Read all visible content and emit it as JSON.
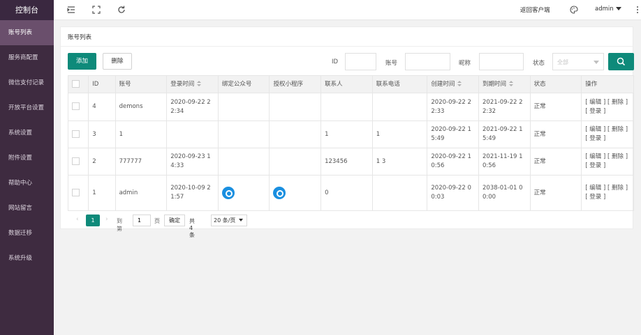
{
  "sidebar": {
    "logo": "控制台",
    "items": [
      {
        "label": "账号列表",
        "active": true
      },
      {
        "label": "服务商配置"
      },
      {
        "label": "微信支付记录"
      },
      {
        "label": "开放平台设置"
      },
      {
        "label": "系统设置"
      },
      {
        "label": "附件设置"
      },
      {
        "label": "帮助中心"
      },
      {
        "label": "网站留言"
      },
      {
        "label": "数据迁移"
      },
      {
        "label": "系统升级"
      }
    ]
  },
  "header": {
    "return_link": "返回客户端",
    "user": "admin",
    "icons": [
      "menu-collapse-icon",
      "fullscreen-icon",
      "refresh-icon",
      "theme-icon",
      "more-vertical-icon"
    ]
  },
  "card": {
    "title": "账号列表",
    "add_label": "添加",
    "delete_label": "删除"
  },
  "filters": {
    "id_label": "ID",
    "id_value": "",
    "account_label": "账号",
    "account_value": "",
    "nickname_label": "昵称",
    "nickname_value": "",
    "status_label": "状态",
    "status_selected": "全部"
  },
  "table": {
    "headers": [
      "",
      "ID",
      "账号",
      "登录时间",
      "绑定公众号",
      "授权小程序",
      "联系人",
      "联系电话",
      "创建时间",
      "到期时间",
      "状态",
      "操作"
    ],
    "rows": [
      {
        "id": "4",
        "account": "demons",
        "login_time": "2020-09-22 22:34",
        "mp": "",
        "mini": "",
        "contact": "",
        "phone": "",
        "created": "2020-09-22 22:33",
        "expire": "2021-09-22 22:32",
        "status": "正常",
        "ops": "[ 编辑 ] [ 删除 ] [ 登录 ]"
      },
      {
        "id": "3",
        "account": "1",
        "login_time": "",
        "mp": "",
        "mini": "",
        "contact": "1",
        "phone": "1",
        "created": "2020-09-22 15:49",
        "expire": "2021-09-22 15:49",
        "status": "正常",
        "ops": "[ 编辑 ] [ 删除 ] [ 登录 ]"
      },
      {
        "id": "2",
        "account": "777777",
        "login_time": "2020-09-23 14:33",
        "mp": "",
        "mini": "",
        "contact": "123456",
        "phone": "1 3",
        "created": "2020-09-22 10:56",
        "expire": "2021-11-19 10:56",
        "status": "正常",
        "ops": "[ 编辑 ] [ 删除 ] [ 登录 ]"
      },
      {
        "id": "1",
        "account": "admin",
        "login_time": "2020-10-09 21:57",
        "mp": "",
        "mini": "",
        "contact": "0",
        "phone": "",
        "created": "2020-09-22 00:03",
        "expire": "2038-01-01 00:00",
        "status": "正常",
        "ops": "[ 编辑 ] [ 删除 ] [ 登录 ]"
      }
    ]
  },
  "pager": {
    "current_page": "1",
    "goto_label": "到第",
    "goto_value": "1",
    "page_unit": "页",
    "confirm_label": "确定",
    "total": "共 4 条",
    "page_size": "20 条/页"
  }
}
